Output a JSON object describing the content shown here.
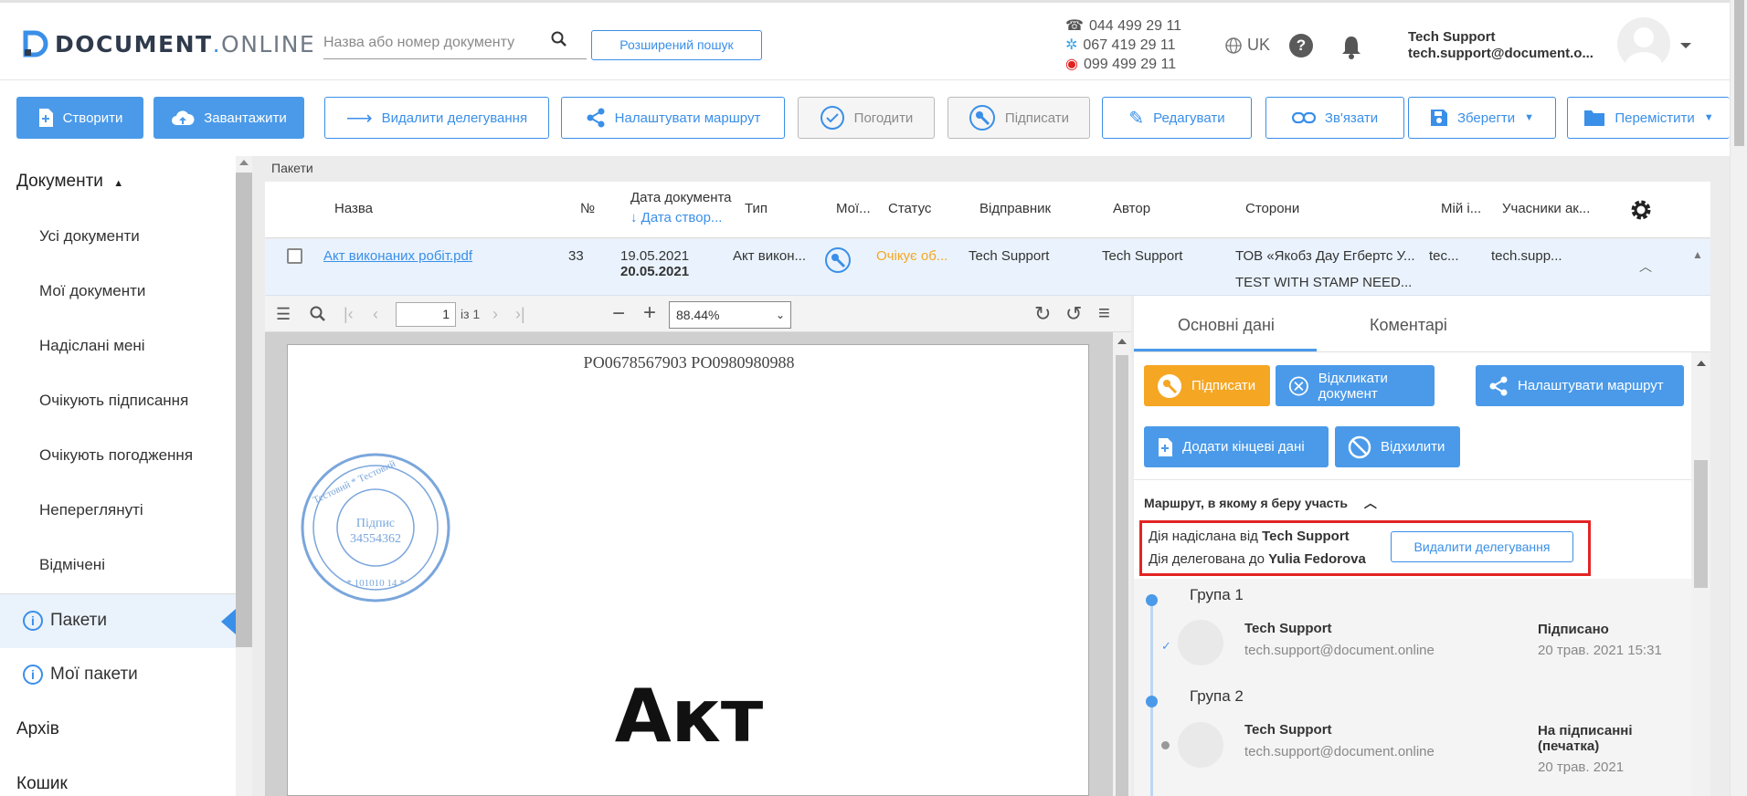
{
  "header": {
    "logo_main": "DOCUMENT",
    "logo_dot": ".",
    "logo_tail": "ONLINE",
    "search_placeholder": "Назва або номер документу",
    "advanced_search": "Розширений пошук",
    "phones": [
      "044 499 29 11",
      "067 419 29 11",
      "099 499 29 11"
    ],
    "lang": "UK",
    "help": "?",
    "user_name": "Tech Support",
    "user_email": "tech.support@document.o..."
  },
  "toolbar": {
    "create": "Створити",
    "upload": "Завантажити",
    "remove_delegation": "Видалити делегування",
    "setup_route": "Налаштувати маршрут",
    "approve": "Погодити",
    "sign": "Підписати",
    "edit": "Редагувати",
    "link": "Зв'язати",
    "save": "Зберегти",
    "move": "Перемістити"
  },
  "sidebar": {
    "documents": "Документи",
    "items": [
      "Усі документи",
      "Мої документи",
      "Надіслані мені",
      "Очікують підписання",
      "Очікують погодження",
      "Непереглянуті",
      "Відмічені"
    ],
    "packages": "Пакети",
    "my_packages": "Мої пакети",
    "archive": "Архів",
    "trash": "Кошик"
  },
  "breadcrumb": "Пакети",
  "table": {
    "headers": {
      "name": "Назва",
      "num": "№",
      "doc_date": "Дата документа",
      "created_date": "↓ Дата створ...",
      "type": "Тип",
      "mine": "Мої...",
      "status": "Статус",
      "sender": "Відправник",
      "author": "Автор",
      "parties": "Сторони",
      "my_id": "Мій і...",
      "participants": "Учасники ак..."
    },
    "row": {
      "name": "Акт виконаних робіт.pdf",
      "num": "33",
      "doc_date": "19.05.2021",
      "created_date": "20.05.2021",
      "type": "Акт викон...",
      "status": "Очікує об...",
      "sender": "Tech Support",
      "author": "Tech Support",
      "party1": "ТОВ «Якобз Дау Егбертс У...",
      "party2": "TEST WITH STAMP NEED...",
      "my_id": "tec...",
      "participants": "tech.supp..."
    }
  },
  "viewer": {
    "page": "1",
    "of": "із 1",
    "zoom": "88.44%",
    "doc_header": "РО0678567903 РО0980980988",
    "stamp_center": "Підпис",
    "stamp_code": "34554362",
    "doc_title": "Акт"
  },
  "panel": {
    "tab_main": "Основні дані",
    "tab_comments": "Коментарі",
    "btn_sign": "Підписати",
    "btn_recall": "Відкликати документ",
    "btn_route": "Налаштувати маршрут",
    "btn_add_final": "Додати кінцеві дані",
    "btn_reject": "Відхилити",
    "route_heading": "Маршрут, в якому я беру участь",
    "sent_by_label": "Дія надіслана від",
    "sent_by": "Tech Support",
    "delegated_label": "Дія делегована до",
    "delegated_to": "Yulia Fedorova",
    "remove_delegation": "Видалити делегування",
    "groups": [
      {
        "title": "Група 1",
        "name": "Tech Support",
        "email": "tech.support@document.online",
        "status": "Підписано",
        "date": "20 трав. 2021 15:31"
      },
      {
        "title": "Група 2",
        "name": "Tech Support",
        "email": "tech.support@document.online",
        "status": "На підписанні (печатка)",
        "date": "20 трав. 2021"
      }
    ]
  },
  "colors": {
    "accent": "#4a9ae9",
    "orange": "#f5a623",
    "highlight": "#e32424"
  }
}
